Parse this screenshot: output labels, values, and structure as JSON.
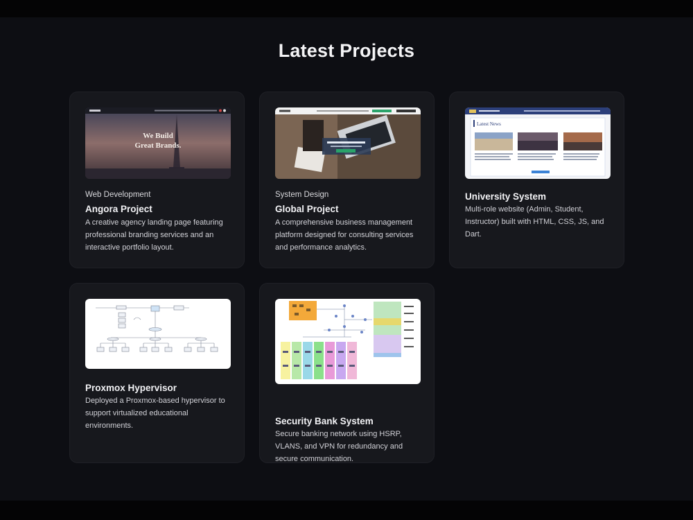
{
  "section": {
    "title": "Latest Projects"
  },
  "projects": [
    {
      "category": "Web Development",
      "title": "Angora Project",
      "description": "A creative agency landing page featuring professional branding services and an interactive portfolio layout.",
      "thumb_text": "We Build Great Brands."
    },
    {
      "category": "System Design",
      "title": "Global Project",
      "description": "A comprehensive business management platform designed for consulting services and performance analytics."
    },
    {
      "category": "",
      "title": "University System",
      "description": "Multi-role website (Admin, Student, Instructor) built with HTML, CSS, JS, and Dart.",
      "thumb_text": "Latest News"
    },
    {
      "category": "",
      "title": "Proxmox Hypervisor",
      "description": "Deployed a Proxmox-based hypervisor to support virtualized educational environments."
    },
    {
      "category": "",
      "title": "Security Bank System",
      "description": "Secure banking network using HSRP, VLANS, and VPN for redundancy and secure communication."
    }
  ],
  "colors": {
    "background": "#0d0e13",
    "card": "#17181d",
    "text": "#f2f2f5"
  }
}
